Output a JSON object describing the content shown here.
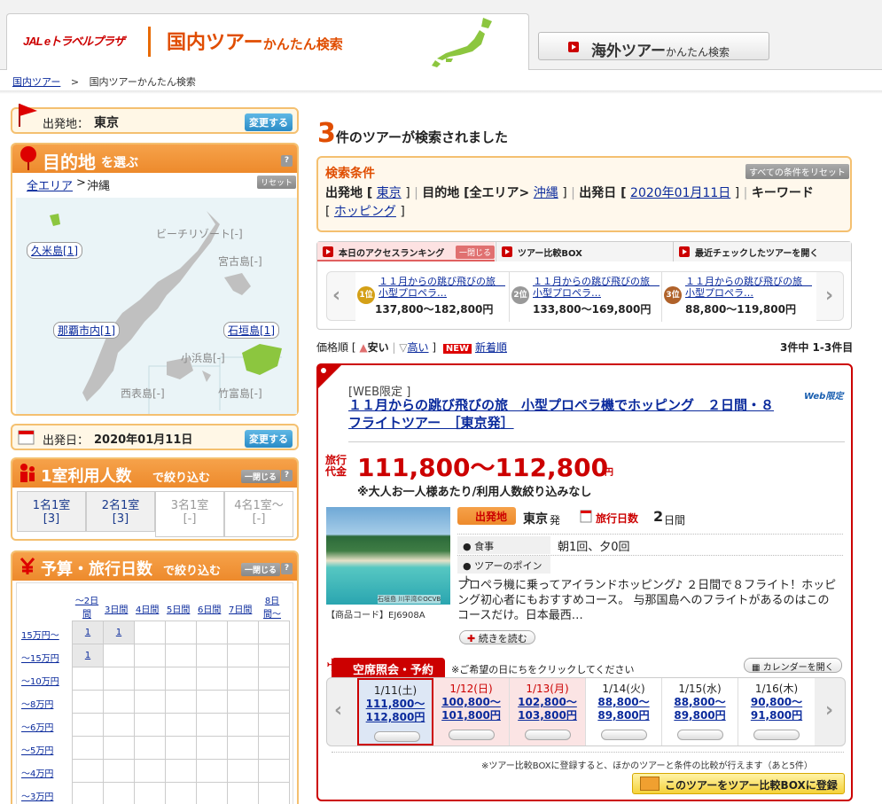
{
  "header": {
    "logo_text": "JAL eトラベルプラザ",
    "tab_main": "国内ツアー",
    "tab_main_sub": "かんたん検索",
    "tab_sub": "海外ツアー",
    "tab_sub_small": "かんたん検索"
  },
  "breadcrumb": {
    "home": "国内ツアー",
    "sep": ">",
    "current": "国内ツアーかんたん検索"
  },
  "departure": {
    "label": "出発地：",
    "value": "東京",
    "change": "変更する"
  },
  "destination": {
    "title": "目的地",
    "title_small": "を選ぶ",
    "help": "?",
    "area_all": "全エリア",
    "area_sep": ">",
    "area_current": "沖縄",
    "reset": "リセット",
    "places": {
      "kume": "久米島[1]",
      "beach": "ビーチリゾート[-]",
      "miyako": "宮古島[-]",
      "naha": "那覇市内[1]",
      "ishigaki": "石垣島[1]",
      "kohama": "小浜島[-]",
      "iriomote": "西表島[-]",
      "taketomi": "竹富島[-]"
    }
  },
  "depdate": {
    "label": "出発日：",
    "value": "2020年01月11日",
    "change": "変更する"
  },
  "people": {
    "title": "1室利用人数",
    "title_small": "で絞り込む",
    "close": "一閉じる",
    "help": "?",
    "options": [
      {
        "l1": "1名1室",
        "l2": "[3]"
      },
      {
        "l1": "2名1室",
        "l2": "[3]"
      },
      {
        "l1": "3名1室",
        "l2": "[-]"
      },
      {
        "l1": "4名1室～",
        "l2": "[-]"
      }
    ]
  },
  "budget": {
    "title": "予算・旅行日数",
    "title_small": "で絞り込む",
    "close": "一閉じる",
    "help": "?",
    "days": [
      "～2日間",
      "3日間",
      "4日間",
      "5日間",
      "6日間",
      "7日間",
      "8日間～"
    ],
    "rows": [
      "15万円～",
      "～15万円",
      "～10万円",
      "～8万円",
      "～6万円",
      "～5万円",
      "～4万円",
      "～3万円"
    ],
    "cell_r0c0": "1",
    "cell_r0c1": "1",
    "cell_r1c0": "1"
  },
  "results": {
    "count": "3",
    "count_text": "件のツアーが検索されました"
  },
  "conditions": {
    "title": "検索条件",
    "reset_all": "すべての条件をリセット",
    "dep_label": "出発地 [",
    "dep_value": "東京",
    "dest_label": "目的地 [全エリア>",
    "dest_value": "沖縄",
    "date_label": "出発日 [",
    "date_value": "2020年01月11日",
    "kw_label": "キーワード",
    "kw_value": "ホッピング",
    "close_br": "]"
  },
  "ranking": {
    "tab1": "本日のアクセスランキング",
    "tab1_close": "一閉じる",
    "tab2": "ツアー比較BOX",
    "tab3": "最近チェックしたツアーを開く",
    "items": [
      {
        "rank": "1位",
        "title": "１１月からの跳び飛びの旅　小型プロペラ…",
        "price": "137,800～182,800円"
      },
      {
        "rank": "2位",
        "title": "１１月からの跳び飛びの旅　小型プロペラ…",
        "price": "133,800～169,800円"
      },
      {
        "rank": "3位",
        "title": "１１月からの跳び飛びの旅　小型プロペラ…",
        "price": "88,800～119,800円"
      }
    ]
  },
  "sort": {
    "label": "価格順 [",
    "cheap": "安い",
    "sep": "|",
    "high": "高い",
    "close": "]",
    "new_badge": "NEW",
    "newest": "新着順",
    "page_info": "3件中 1-3件目"
  },
  "tour": {
    "web_limited": "[WEB限定 ]",
    "web_badge": "Web限定",
    "title": "１１月からの跳び飛びの旅　小型プロペラ機でホッピング　２日間・８フライトツアー　［東京発］",
    "price_label": "旅行代金",
    "price": "111,800～112,800",
    "price_unit": "円",
    "price_note": "※大人お一人様あたり/利用人数絞り込みなし",
    "photo_caption": "石垣島 川平湾©OCVB",
    "code": "【商品コード】EJ6908A",
    "dep_badge": "出発地",
    "dep_value": "東京",
    "dep_suffix": "発",
    "days_label": "旅行日数",
    "days_value": "2",
    "days_unit": "日間",
    "meal_label": "食事",
    "meal_value": "朝1回、夕0回",
    "point_label": "ツアーのポイント",
    "desc": "プロペラ機に乗ってアイランドホッピング♪ ２日間で８フライト！ホッピング初心者にもおすすめコース。 与那国島へのフライトがあるのはこのコースだけ。日本最西…",
    "more": "続きを読む",
    "avail_title": "空席照会・予約",
    "avail_note": "※ご希望の日にちをクリックしてください",
    "calendar": "カレンダーを開く",
    "dates": [
      {
        "d": "1/11(土)",
        "p1": "111,800～",
        "p2": "112,800円"
      },
      {
        "d": "1/12(日)",
        "p1": "100,800～",
        "p2": "101,800円"
      },
      {
        "d": "1/13(月)",
        "p1": "102,800～",
        "p2": "103,800円"
      },
      {
        "d": "1/14(火)",
        "p1": "88,800～",
        "p2": "89,800円"
      },
      {
        "d": "1/15(水)",
        "p1": "88,800～",
        "p2": "89,800円"
      },
      {
        "d": "1/16(木)",
        "p1": "90,800～",
        "p2": "91,800円"
      }
    ],
    "compare_note": "※ツアー比較BOXに登録すると、ほかのツアーと条件の比較が行えます（あと5件）",
    "compare_btn": "このツアーをツアー比較BOXに登録"
  },
  "colors": {
    "accent": "#e04d00",
    "red": "#c00000",
    "orange_border": "#f4c070",
    "link": "#0a2a9c"
  }
}
